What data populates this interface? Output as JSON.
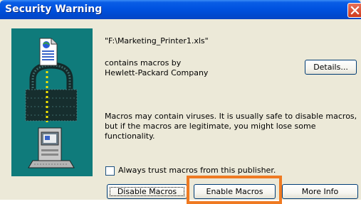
{
  "window": {
    "title": "Security Warning"
  },
  "message": {
    "file_path": "\"F:\\Marketing_Printer1.xls\"",
    "contains_label": "contains macros by",
    "publisher": "Hewlett-Packard Company",
    "warning": "Macros may contain viruses. It is usually safe to disable macros, but if the macros are legitimate, you might lose some functionality."
  },
  "buttons": {
    "details": "Details...",
    "disable": "Disable Macros",
    "enable": "Enable Macros",
    "more_info": "More Info"
  },
  "options": {
    "always_trust_label": "Always trust macros from this publisher.",
    "always_trust_checked": false
  },
  "colors": {
    "title_bar": "#0052e0",
    "dialog_bg": "#ece9d8",
    "icon_panel": "#0f7b7b",
    "highlight": "#ef7a22"
  }
}
